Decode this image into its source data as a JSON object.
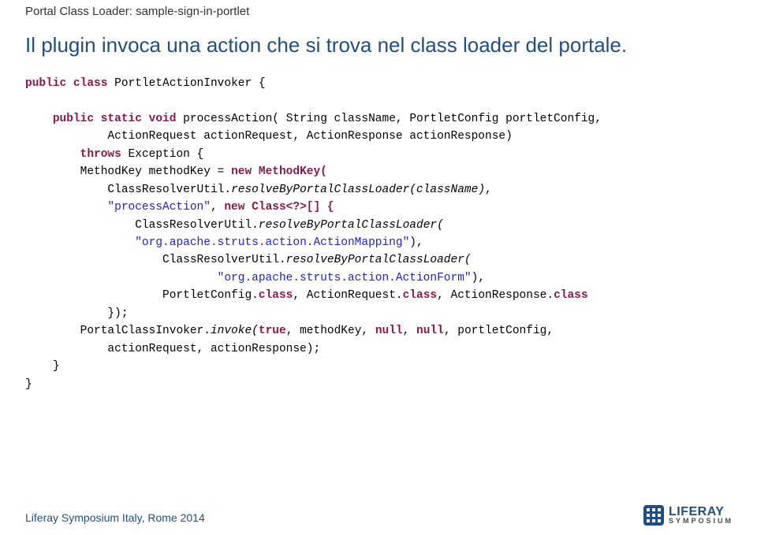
{
  "breadcrumb": "Portal Class Loader: sample-sign-in-portlet",
  "title": "Il plugin invoca una action che si trova nel class loader del portale.",
  "code": {
    "l1_kw1": "public",
    "l1_kw2": "class",
    "l1_cls": " PortletActionInvoker {",
    "l2_kw1": "public",
    "l2_kw2": "static",
    "l2_kw3": "void",
    "l2_rest": " processAction( String className, PortletConfig portletConfig,",
    "l3": "ActionRequest actionRequest, ActionResponse actionResponse)",
    "l4_kw1": "throws",
    "l4_rest": " Exception {",
    "l5a": "MethodKey methodKey = ",
    "l5_kw": "new",
    "l5b": " MethodKey(",
    "l6a": "ClassResolverUtil.",
    "l6b": "resolveByPortalClassLoader(className)",
    "l6c": ",",
    "l7_str": "\"processAction\"",
    "l7a": ", ",
    "l7_kw": "new",
    "l7b": " Class<?>[] {",
    "l8a": "ClassResolverUtil.",
    "l8b": "resolveByPortalClassLoader(",
    "l9_str": "\"org.apache.struts.action.ActionMapping\"",
    "l9a": "),",
    "l10a": "ClassResolverUtil.",
    "l10b": "resolveByPortalClassLoader(",
    "l11_str": "\"org.apache.struts.action.ActionForm\"",
    "l11a": "),",
    "l12a": "PortletConfig.",
    "l12b": "class",
    "l12c": ", ActionRequest.",
    "l12d": "class",
    "l12e": ", ActionResponse.",
    "l12f": "class",
    "l13": "});",
    "l14a": "PortalClassInvoker.",
    "l14b": "invoke(",
    "l14_true": "true",
    "l14c": ", methodKey, ",
    "l14_null1": "null",
    "l14d": ", ",
    "l14_null2": "null",
    "l14e": ", portletConfig,",
    "l15": "actionRequest, actionResponse);",
    "l16": "}",
    "l17": "}"
  },
  "footer": "Liferay Symposium Italy, Rome 2014",
  "logo": {
    "name": "LIFERAY",
    "sub": "SYMPOSIUM"
  }
}
